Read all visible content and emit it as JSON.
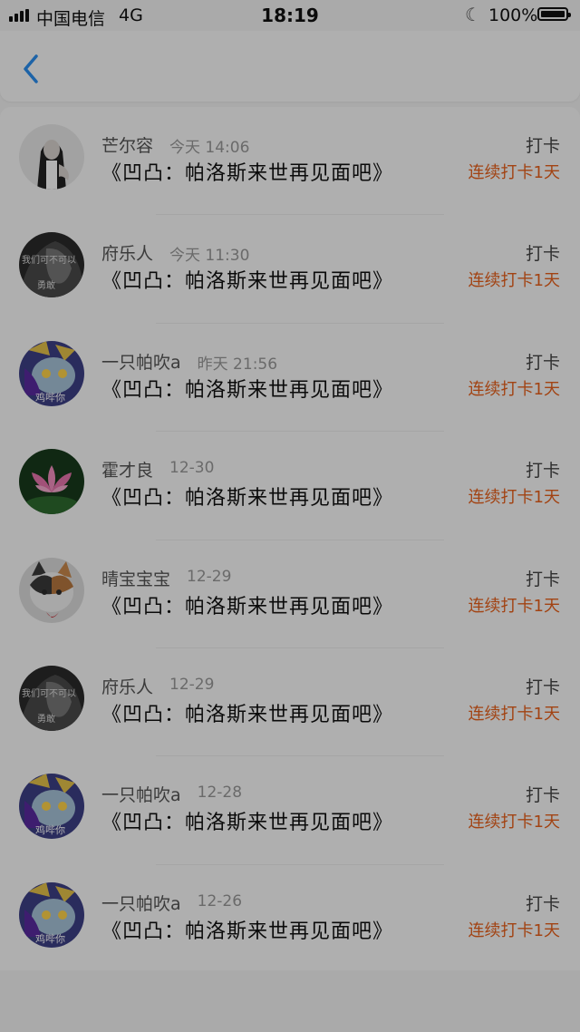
{
  "status_bar": {
    "carrier": "中国电信",
    "network": "4G",
    "time": "18:19",
    "battery": "100%",
    "battery_level": 1.0
  },
  "nav": {
    "back_icon": "chevron-left-icon",
    "accent_color": "#2a8ff0"
  },
  "list": {
    "items": [
      {
        "user": "芒尔容",
        "time": "今天 14:06",
        "title": "《凹凸：帕洛斯来世再见面吧》",
        "action": "打卡",
        "streak": "连续打卡1天",
        "avatar": "avatar-girl"
      },
      {
        "user": "府乐人",
        "time": "今天 11:30",
        "title": "《凹凸：帕洛斯来世再见面吧》",
        "action": "打卡",
        "streak": "连续打卡1天",
        "avatar": "avatar-dark"
      },
      {
        "user": "一只帕吹a",
        "time": "昨天 21:56",
        "title": "《凹凸：帕洛斯来世再见面吧》",
        "action": "打卡",
        "streak": "连续打卡1天",
        "avatar": "avatar-anime"
      },
      {
        "user": "霍才良",
        "time": "12-30",
        "title": "《凹凸：帕洛斯来世再见面吧》",
        "action": "打卡",
        "streak": "连续打卡1天",
        "avatar": "avatar-lotus"
      },
      {
        "user": "晴宝宝宝",
        "time": "12-29",
        "title": "《凹凸：帕洛斯来世再见面吧》",
        "action": "打卡",
        "streak": "连续打卡1天",
        "avatar": "avatar-cat"
      },
      {
        "user": "府乐人",
        "time": "12-29",
        "title": "《凹凸：帕洛斯来世再见面吧》",
        "action": "打卡",
        "streak": "连续打卡1天",
        "avatar": "avatar-dark"
      },
      {
        "user": "一只帕吹a",
        "time": "12-28",
        "title": "《凹凸：帕洛斯来世再见面吧》",
        "action": "打卡",
        "streak": "连续打卡1天",
        "avatar": "avatar-anime"
      },
      {
        "user": "一只帕吹a",
        "time": "12-26",
        "title": "《凹凸：帕洛斯来世再见面吧》",
        "action": "打卡",
        "streak": "连续打卡1天",
        "avatar": "avatar-anime"
      }
    ]
  },
  "avatar_text": {
    "dark": "我们可不可以",
    "dark2": "勇敢",
    "anime": "鸡哔你"
  },
  "colors": {
    "streak": "#e8611c",
    "overlay": "rgba(0,0,0,0.30)"
  }
}
